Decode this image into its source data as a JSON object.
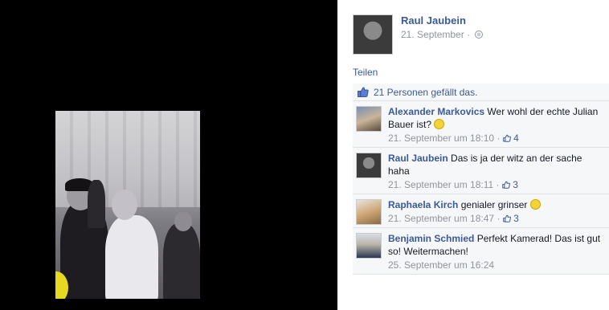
{
  "post": {
    "author": "Raul Jaubein",
    "date": "21. September",
    "share_label": "Teilen",
    "likes_text": "21 Personen gefällt das."
  },
  "comments": [
    {
      "name": "Alexander Markovics",
      "text": "Wer wohl der echte Julian Bauer ist?",
      "time": "21. September um 18:10",
      "likes": "4"
    },
    {
      "name": "Raul Jaubein",
      "text": "Das is ja der witz an der sache haha",
      "time": "21. September um 18:11",
      "likes": "3"
    },
    {
      "name": "Raphaela Kirch",
      "text": "genialer grinser",
      "time": "21. September um 18:47",
      "likes": "3"
    },
    {
      "name": "Benjamin Schmied",
      "text": "Perfekt Kamerad! Das ist gut so! Weitermachen!",
      "time": "25. September um 16:24",
      "likes": ""
    }
  ],
  "colors": {
    "link": "#3b5998",
    "meta": "#90949c",
    "panel": "#f6f7f9"
  }
}
